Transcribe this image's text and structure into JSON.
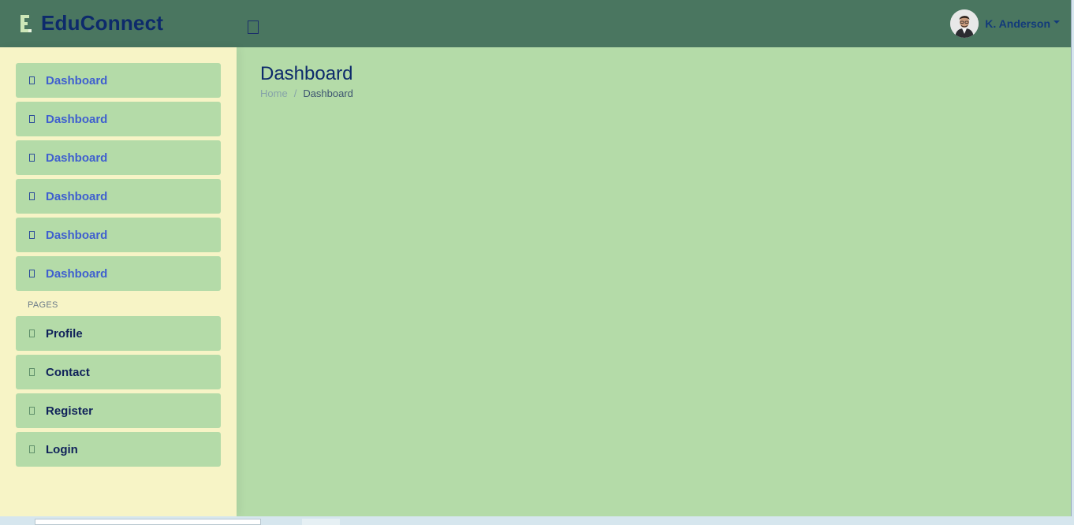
{
  "header": {
    "brand": "EduConnect",
    "user_name": "K. Anderson"
  },
  "sidebar": {
    "items": [
      {
        "label": "Dashboard"
      },
      {
        "label": "Dashboard"
      },
      {
        "label": "Dashboard"
      },
      {
        "label": "Dashboard"
      },
      {
        "label": "Dashboard"
      },
      {
        "label": "Dashboard"
      }
    ],
    "pages_section": "PAGES",
    "pages": [
      {
        "label": "Profile"
      },
      {
        "label": "Contact"
      },
      {
        "label": "Register"
      },
      {
        "label": "Login"
      }
    ]
  },
  "main": {
    "title": "Dashboard",
    "breadcrumb": {
      "home": "Home",
      "separator": "/",
      "current": "Dashboard"
    }
  },
  "colors": {
    "header_bg": "#4a7660",
    "sidebar_bg": "#f7f4c6",
    "content_bg": "#b4dba8",
    "brand_text": "#0d2a6b",
    "nav_text": "#3f5fcf",
    "page_nav_text": "#10225a"
  },
  "icons": {
    "logo": "educonnect-logo-icon",
    "toggle": "menu-toggle-icon",
    "nav": "dashboard-icon",
    "pages": "page-icon"
  }
}
